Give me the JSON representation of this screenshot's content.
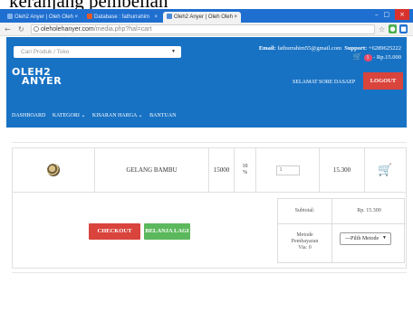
{
  "caption": "keranjang pembelian",
  "browser": {
    "tabs": [
      {
        "label": "Oleh2 Anyer | Oleh Oleh",
        "fav_color": "#1f6fd0"
      },
      {
        "label": "Database : fathurrahim",
        "fav_color": "#e05a2b"
      },
      {
        "label": "Oleh2 Anyer | Oleh Oleh",
        "fav_color": "#4b8bd9"
      }
    ],
    "tab_close": "×",
    "url_host": "oleholehanyer.com",
    "url_path": "/media.php?hal=cart",
    "window_controls": [
      "–",
      "□"
    ],
    "window_close": "×"
  },
  "header": {
    "search_placeholder": "Cari Produk / Toko",
    "email_label": "Email:",
    "email": "fathurrahim55@gmail.com",
    "support_label": "Support:",
    "support": "+6289625222",
    "cart_count": "1",
    "cart_total": "- Rp.15.000",
    "logo_line1": "OLEH2",
    "logo_line2": "ANYER",
    "greeting": "SELAMAT SORE DASAEP",
    "logout_label": "LOGOUT",
    "menu": [
      {
        "label": "DASHBOARD"
      },
      {
        "label": "KATEGORI ⌄"
      },
      {
        "label": "KISARAN HARGA ⌄"
      },
      {
        "label": "BANTUAN"
      }
    ]
  },
  "cart": {
    "item": {
      "name": "GELANG BAMBU",
      "price": "15000",
      "discount_line1": "10",
      "discount_line2": "%",
      "qty": "1",
      "subtotal": "15.300"
    },
    "checkout_label": "CHECKOUT",
    "continue_label": "BELANJA LAGI",
    "summary": {
      "subtotal_label": "Subtotal:",
      "subtotal_value": "Rp. 15.300",
      "payment_label_1": "Metode",
      "payment_label_2": "Pembayaran",
      "payment_label_3": "Via: 0",
      "payment_select": "---Pilih Metode"
    }
  },
  "colors": {
    "header_blue": "#1872c4",
    "logout_red": "#d9443c",
    "checkout_red": "#d9443c",
    "continue_green": "#5cb85c"
  }
}
